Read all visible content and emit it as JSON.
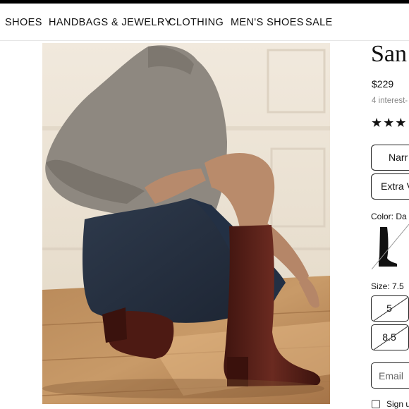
{
  "nav": {
    "items": [
      "SHOES",
      "HANDBAGS & JEWELRY",
      "CLOTHING",
      "MEN'S SHOES",
      "SALE"
    ]
  },
  "product": {
    "title": "San",
    "price": "$229",
    "installments": "4 interest-",
    "rating_icon": "star-rating-icons",
    "width_options": [
      "Narr",
      "Extra V"
    ],
    "color_label": "Color:  Da",
    "size_label": "Size:  7.5",
    "sizes": [
      {
        "label": "5",
        "available": false
      },
      {
        "label": "8.5",
        "available": false
      }
    ],
    "email_placeholder": "Email",
    "signup_label": "Sign u"
  },
  "colors": {
    "nav_text": "#111111",
    "border": "#222222",
    "muted": "#888888",
    "boot": "#5a1f17"
  }
}
